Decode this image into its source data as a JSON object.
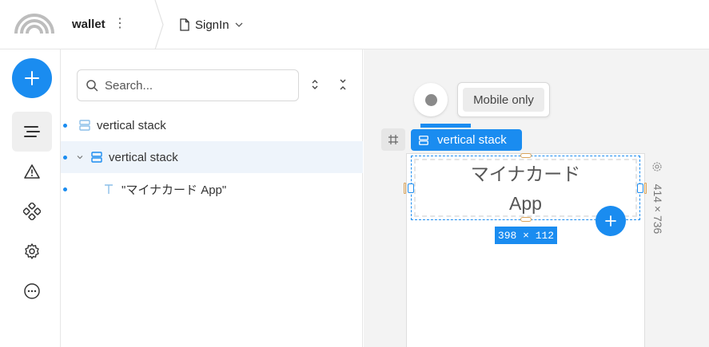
{
  "header": {
    "project_name": "wallet",
    "more_glyph": "⋮",
    "page_name": "SignIn",
    "page_icon": "file-icon",
    "dropdown_icon": "chevron-down-icon"
  },
  "rail": {
    "add_icon": "plus-icon",
    "items": [
      {
        "name": "layers",
        "icon": "layers-list-icon",
        "active": true
      },
      {
        "name": "warnings",
        "icon": "warning-icon",
        "active": false
      },
      {
        "name": "components",
        "icon": "components-icon",
        "active": false
      },
      {
        "name": "settings",
        "icon": "gear-icon",
        "active": false
      },
      {
        "name": "more",
        "icon": "more-circle-icon",
        "active": false
      }
    ]
  },
  "layers": {
    "search_placeholder": "Search...",
    "search_value": "",
    "tree": [
      {
        "label": "vertical stack",
        "type": "stack",
        "indent": 0,
        "selected": false,
        "expanded": false
      },
      {
        "label": "vertical stack",
        "type": "stack",
        "indent": 1,
        "selected": true,
        "expanded": true
      },
      {
        "label": "\"マイナカード App\"",
        "type": "text",
        "indent": 2,
        "selected": false
      }
    ]
  },
  "canvas": {
    "visibility_label": "Mobile only",
    "selection_label": "vertical stack",
    "text_line1": "マイナカード",
    "text_line2": "App",
    "selection_size": "398 × 112",
    "device_size": "414 × 736",
    "accent": "#1a8cf0"
  }
}
